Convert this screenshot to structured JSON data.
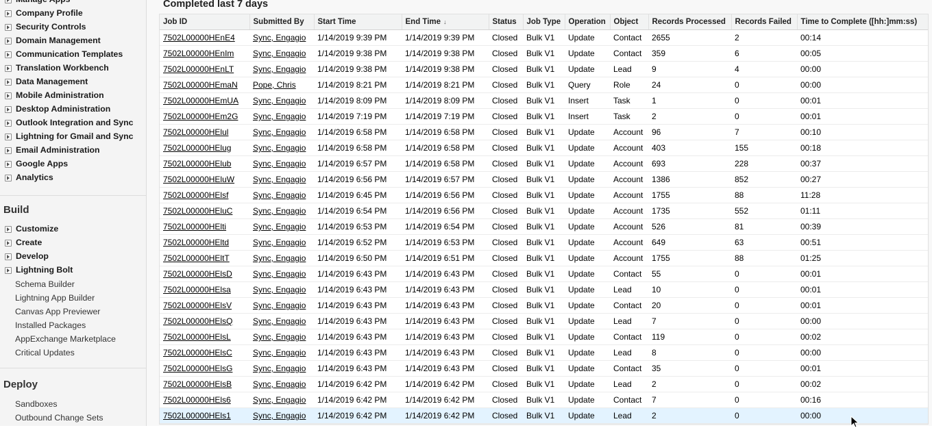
{
  "sidebar": {
    "admin_items": [
      "Manage Apps",
      "Company Profile",
      "Security Controls",
      "Domain Management",
      "Communication Templates",
      "Translation Workbench",
      "Data Management",
      "Mobile Administration",
      "Desktop Administration",
      "Outlook Integration and Sync",
      "Lightning for Gmail and Sync",
      "Email Administration",
      "Google Apps",
      "Analytics"
    ],
    "build": {
      "title": "Build",
      "expandable": [
        "Customize",
        "Create",
        "Develop",
        "Lightning Bolt"
      ],
      "links": [
        "Schema Builder",
        "Lightning App Builder",
        "Canvas App Previewer",
        "Installed Packages",
        "AppExchange Marketplace",
        "Critical Updates"
      ]
    },
    "deploy": {
      "title": "Deploy",
      "links": [
        "Sandboxes",
        "Outbound Change Sets"
      ]
    }
  },
  "main": {
    "heading": "Completed last 7 days",
    "columns": [
      "Job ID",
      "Submitted By",
      "Start Time",
      "End Time",
      "Status",
      "Job Type",
      "Operation",
      "Object",
      "Records Processed",
      "Records Failed",
      "Time to Complete ([hh:]mm:ss)"
    ],
    "sorted_column": "End Time",
    "sort_icon": "arrow-down-icon",
    "highlight_color": "#e3f3ff",
    "rows": [
      [
        "7502L00000HEnE4",
        "Sync, Engagio",
        "1/14/2019 9:39 PM",
        "1/14/2019 9:39 PM",
        "Closed",
        "Bulk V1",
        "Update",
        "Contact",
        "2655",
        "2",
        "00:14"
      ],
      [
        "7502L00000HEnIm",
        "Sync, Engagio",
        "1/14/2019 9:38 PM",
        "1/14/2019 9:38 PM",
        "Closed",
        "Bulk V1",
        "Update",
        "Contact",
        "359",
        "6",
        "00:05"
      ],
      [
        "7502L00000HEnLT",
        "Sync, Engagio",
        "1/14/2019 9:38 PM",
        "1/14/2019 9:38 PM",
        "Closed",
        "Bulk V1",
        "Update",
        "Lead",
        "9",
        "4",
        "00:00"
      ],
      [
        "7502L00000HEmaN",
        "Pope, Chris",
        "1/14/2019 8:21 PM",
        "1/14/2019 8:21 PM",
        "Closed",
        "Bulk V1",
        "Query",
        "Role",
        "24",
        "0",
        "00:00"
      ],
      [
        "7502L00000HEmUA",
        "Sync, Engagio",
        "1/14/2019 8:09 PM",
        "1/14/2019 8:09 PM",
        "Closed",
        "Bulk V1",
        "Insert",
        "Task",
        "1",
        "0",
        "00:01"
      ],
      [
        "7502L00000HEm2G",
        "Sync, Engagio",
        "1/14/2019 7:19 PM",
        "1/14/2019 7:19 PM",
        "Closed",
        "Bulk V1",
        "Insert",
        "Task",
        "2",
        "0",
        "00:01"
      ],
      [
        "7502L00000HElul",
        "Sync, Engagio",
        "1/14/2019 6:58 PM",
        "1/14/2019 6:58 PM",
        "Closed",
        "Bulk V1",
        "Update",
        "Account",
        "96",
        "7",
        "00:10"
      ],
      [
        "7502L00000HElug",
        "Sync, Engagio",
        "1/14/2019 6:58 PM",
        "1/14/2019 6:58 PM",
        "Closed",
        "Bulk V1",
        "Update",
        "Account",
        "403",
        "155",
        "00:18"
      ],
      [
        "7502L00000HElub",
        "Sync, Engagio",
        "1/14/2019 6:57 PM",
        "1/14/2019 6:58 PM",
        "Closed",
        "Bulk V1",
        "Update",
        "Account",
        "693",
        "228",
        "00:37"
      ],
      [
        "7502L00000HEluW",
        "Sync, Engagio",
        "1/14/2019 6:56 PM",
        "1/14/2019 6:57 PM",
        "Closed",
        "Bulk V1",
        "Update",
        "Account",
        "1386",
        "852",
        "00:27"
      ],
      [
        "7502L00000HElsf",
        "Sync, Engagio",
        "1/14/2019 6:45 PM",
        "1/14/2019 6:56 PM",
        "Closed",
        "Bulk V1",
        "Update",
        "Account",
        "1755",
        "88",
        "11:28"
      ],
      [
        "7502L00000HEluC",
        "Sync, Engagio",
        "1/14/2019 6:54 PM",
        "1/14/2019 6:56 PM",
        "Closed",
        "Bulk V1",
        "Update",
        "Account",
        "1735",
        "552",
        "01:11"
      ],
      [
        "7502L00000HElti",
        "Sync, Engagio",
        "1/14/2019 6:53 PM",
        "1/14/2019 6:54 PM",
        "Closed",
        "Bulk V1",
        "Update",
        "Account",
        "526",
        "81",
        "00:39"
      ],
      [
        "7502L00000HEltd",
        "Sync, Engagio",
        "1/14/2019 6:52 PM",
        "1/14/2019 6:53 PM",
        "Closed",
        "Bulk V1",
        "Update",
        "Account",
        "649",
        "63",
        "00:51"
      ],
      [
        "7502L00000HEltT",
        "Sync, Engagio",
        "1/14/2019 6:50 PM",
        "1/14/2019 6:51 PM",
        "Closed",
        "Bulk V1",
        "Update",
        "Account",
        "1755",
        "88",
        "01:25"
      ],
      [
        "7502L00000HElsD",
        "Sync, Engagio",
        "1/14/2019 6:43 PM",
        "1/14/2019 6:43 PM",
        "Closed",
        "Bulk V1",
        "Update",
        "Contact",
        "55",
        "0",
        "00:01"
      ],
      [
        "7502L00000HElsa",
        "Sync, Engagio",
        "1/14/2019 6:43 PM",
        "1/14/2019 6:43 PM",
        "Closed",
        "Bulk V1",
        "Update",
        "Lead",
        "10",
        "0",
        "00:01"
      ],
      [
        "7502L00000HElsV",
        "Sync, Engagio",
        "1/14/2019 6:43 PM",
        "1/14/2019 6:43 PM",
        "Closed",
        "Bulk V1",
        "Update",
        "Contact",
        "20",
        "0",
        "00:01"
      ],
      [
        "7502L00000HElsQ",
        "Sync, Engagio",
        "1/14/2019 6:43 PM",
        "1/14/2019 6:43 PM",
        "Closed",
        "Bulk V1",
        "Update",
        "Lead",
        "7",
        "0",
        "00:00"
      ],
      [
        "7502L00000HElsL",
        "Sync, Engagio",
        "1/14/2019 6:43 PM",
        "1/14/2019 6:43 PM",
        "Closed",
        "Bulk V1",
        "Update",
        "Contact",
        "119",
        "0",
        "00:02"
      ],
      [
        "7502L00000HElsC",
        "Sync, Engagio",
        "1/14/2019 6:43 PM",
        "1/14/2019 6:43 PM",
        "Closed",
        "Bulk V1",
        "Update",
        "Lead",
        "8",
        "0",
        "00:00"
      ],
      [
        "7502L00000HElsG",
        "Sync, Engagio",
        "1/14/2019 6:43 PM",
        "1/14/2019 6:43 PM",
        "Closed",
        "Bulk V1",
        "Update",
        "Contact",
        "35",
        "0",
        "00:01"
      ],
      [
        "7502L00000HElsB",
        "Sync, Engagio",
        "1/14/2019 6:42 PM",
        "1/14/2019 6:42 PM",
        "Closed",
        "Bulk V1",
        "Update",
        "Lead",
        "2",
        "0",
        "00:02"
      ],
      [
        "7502L00000HEls6",
        "Sync, Engagio",
        "1/14/2019 6:42 PM",
        "1/14/2019 6:42 PM",
        "Closed",
        "Bulk V1",
        "Update",
        "Contact",
        "7",
        "0",
        "00:16"
      ],
      [
        "7502L00000HEls1",
        "Sync, Engagio",
        "1/14/2019 6:42 PM",
        "1/14/2019 6:42 PM",
        "Closed",
        "Bulk V1",
        "Update",
        "Lead",
        "2",
        "0",
        "00:00"
      ]
    ],
    "highlighted_row_index": 24
  }
}
